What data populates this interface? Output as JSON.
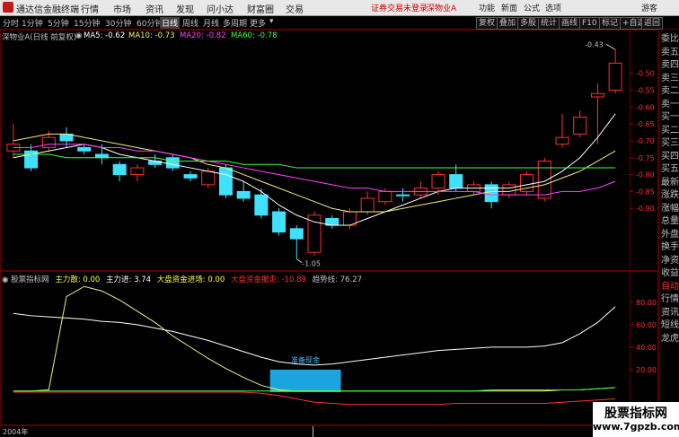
{
  "titlebar": {
    "app_name": "通达信金融终端",
    "menu": [
      "行情",
      "市场",
      "资讯",
      "发现",
      "问小达",
      "财富圈",
      "交易"
    ],
    "warning": "证券交易未登录",
    "stock_tag": "深物业A",
    "right_menu": [
      "功能",
      "新面",
      "公式",
      "选项"
    ],
    "guest": "游客"
  },
  "toolbar": {
    "periods": [
      "分时",
      "1分钟",
      "5分钟",
      "15分钟",
      "30分钟",
      "60分钟",
      "日线",
      "周线",
      "月线",
      "多周期",
      "更多"
    ],
    "active_period": "日线",
    "buttons": [
      "复权",
      "叠加",
      "多股",
      "统计",
      "画线",
      "F10",
      "标记",
      "+自选",
      "返回"
    ]
  },
  "kline_legend": {
    "title": "深物业A(日线 前复权)",
    "ma5": "MA5: -0.62",
    "ma10": "MA10: -0.73",
    "ma20": "MA20: -0.82",
    "ma60": "MA60: -0.78",
    "colors": {
      "ma5": "#ffffff",
      "ma10": "#f0f080",
      "ma20": "#ff40ff",
      "ma60": "#40ff40"
    }
  },
  "indicator_legend": {
    "name": "股票指标网",
    "items": [
      {
        "text": "主力散: 0.00",
        "color": "#ffff40"
      },
      {
        "text": "主力进: 3.74",
        "color": "#ffffff"
      },
      {
        "text": "大盘资金进场: 0.00",
        "color": "#ffff40"
      },
      {
        "text": "大盘资金撤走: -10.89",
        "color": "#ff3030"
      },
      {
        "text": "趋势线: 76.27",
        "color": "#c0c0c0"
      }
    ]
  },
  "annotations": {
    "high_label": "-0.43",
    "low_label": "-1.05",
    "box_label": "准备现金",
    "date_label": "2004年"
  },
  "right_panel": [
    {
      "text": "委比",
      "cls": ""
    },
    {
      "text": "卖五",
      "cls": ""
    },
    {
      "text": "卖四",
      "cls": ""
    },
    {
      "text": "卖三",
      "cls": ""
    },
    {
      "text": "卖二",
      "cls": ""
    },
    {
      "text": "卖一",
      "cls": ""
    },
    {
      "text": "买一",
      "cls": ""
    },
    {
      "text": "买二",
      "cls": ""
    },
    {
      "text": "买三",
      "cls": ""
    },
    {
      "text": "买四",
      "cls": ""
    },
    {
      "text": "买五",
      "cls": ""
    },
    {
      "text": "最新",
      "cls": ""
    },
    {
      "text": "涨跌",
      "cls": ""
    },
    {
      "text": "涨幅",
      "cls": ""
    },
    {
      "text": "总量",
      "cls": ""
    },
    {
      "text": "外盘",
      "cls": ""
    },
    {
      "text": "换手",
      "cls": ""
    },
    {
      "text": "净资",
      "cls": ""
    },
    {
      "text": "收益",
      "cls": ""
    },
    {
      "text": "自动",
      "cls": "up"
    },
    {
      "text": "行情",
      "cls": ""
    },
    {
      "text": "资讯",
      "cls": ""
    },
    {
      "text": "短线",
      "cls": ""
    },
    {
      "text": "龙虎",
      "cls": ""
    }
  ],
  "watermark": {
    "line1": "股票指标网",
    "line2": "www.7gpzb.com"
  },
  "chart_data": [
    {
      "type": "candlestick",
      "ylim": [
        -1.08,
        -0.4
      ],
      "y_ticks": [
        -0.5,
        -0.55,
        -0.6,
        -0.65,
        -0.7,
        -0.75,
        -0.8,
        -0.85,
        -0.9
      ],
      "candles": [
        {
          "o": -0.73,
          "c": -0.71,
          "h": -0.65,
          "l": -0.75
        },
        {
          "o": -0.73,
          "c": -0.78,
          "h": -0.71,
          "l": -0.79
        },
        {
          "o": -0.72,
          "c": -0.69,
          "h": -0.67,
          "l": -0.73
        },
        {
          "o": -0.68,
          "c": -0.7,
          "h": -0.66,
          "l": -0.72
        },
        {
          "o": -0.72,
          "c": -0.73,
          "h": -0.71,
          "l": -0.74
        },
        {
          "o": -0.74,
          "c": -0.75,
          "h": -0.71,
          "l": -0.77
        },
        {
          "o": -0.77,
          "c": -0.8,
          "h": -0.76,
          "l": -0.82
        },
        {
          "o": -0.8,
          "c": -0.78,
          "h": -0.77,
          "l": -0.82
        },
        {
          "o": -0.76,
          "c": -0.77,
          "h": -0.74,
          "l": -0.78
        },
        {
          "o": -0.75,
          "c": -0.78,
          "h": -0.74,
          "l": -0.79
        },
        {
          "o": -0.8,
          "c": -0.81,
          "h": -0.79,
          "l": -0.82
        },
        {
          "o": -0.83,
          "c": -0.79,
          "h": -0.78,
          "l": -0.84
        },
        {
          "o": -0.78,
          "c": -0.86,
          "h": -0.77,
          "l": -0.87
        },
        {
          "o": -0.85,
          "c": -0.87,
          "h": -0.82,
          "l": -0.88
        },
        {
          "o": -0.86,
          "c": -0.92,
          "h": -0.84,
          "l": -0.93
        },
        {
          "o": -0.91,
          "c": -0.97,
          "h": -0.9,
          "l": -0.98
        },
        {
          "o": -0.96,
          "c": -0.99,
          "h": -0.95,
          "l": -1.05
        },
        {
          "o": -1.03,
          "c": -0.92,
          "h": -0.91,
          "l": -1.04
        },
        {
          "o": -0.93,
          "c": -0.95,
          "h": -0.92,
          "l": -0.96
        },
        {
          "o": -0.95,
          "c": -0.91,
          "h": -0.9,
          "l": -0.96
        },
        {
          "o": -0.91,
          "c": -0.87,
          "h": -0.85,
          "l": -0.92
        },
        {
          "o": -0.88,
          "c": -0.85,
          "h": -0.84,
          "l": -0.89
        },
        {
          "o": -0.86,
          "c": -0.86,
          "h": -0.84,
          "l": -0.88
        },
        {
          "o": -0.86,
          "c": -0.84,
          "h": -0.82,
          "l": -0.87
        },
        {
          "o": -0.84,
          "c": -0.8,
          "h": -0.79,
          "l": -0.86
        },
        {
          "o": -0.8,
          "c": -0.84,
          "h": -0.77,
          "l": -0.85
        },
        {
          "o": -0.85,
          "c": -0.83,
          "h": -0.82,
          "l": -0.86
        },
        {
          "o": -0.83,
          "c": -0.88,
          "h": -0.82,
          "l": -0.9
        },
        {
          "o": -0.86,
          "c": -0.83,
          "h": -0.82,
          "l": -0.87
        },
        {
          "o": -0.85,
          "c": -0.8,
          "h": -0.79,
          "l": -0.86
        },
        {
          "o": -0.87,
          "c": -0.76,
          "h": -0.75,
          "l": -0.88
        },
        {
          "o": -0.71,
          "c": -0.69,
          "h": -0.62,
          "l": -0.72
        },
        {
          "o": -0.68,
          "c": -0.63,
          "h": -0.61,
          "l": -0.69
        },
        {
          "o": -0.57,
          "c": -0.56,
          "h": -0.53,
          "l": -0.71
        },
        {
          "o": -0.55,
          "c": -0.47,
          "h": -0.43,
          "l": -0.56
        }
      ],
      "ma": [
        {
          "name": "MA5",
          "color": "#ffffff",
          "values": [
            -0.75,
            -0.74,
            -0.73,
            -0.72,
            -0.71,
            -0.72,
            -0.74,
            -0.75,
            -0.76,
            -0.77,
            -0.78,
            -0.79,
            -0.8,
            -0.82,
            -0.85,
            -0.89,
            -0.92,
            -0.94,
            -0.95,
            -0.95,
            -0.93,
            -0.91,
            -0.89,
            -0.87,
            -0.85,
            -0.84,
            -0.84,
            -0.84,
            -0.84,
            -0.83,
            -0.82,
            -0.79,
            -0.75,
            -0.69,
            -0.62
          ]
        },
        {
          "name": "MA10",
          "color": "#f0f080",
          "values": [
            -0.7,
            -0.69,
            -0.68,
            -0.68,
            -0.69,
            -0.7,
            -0.71,
            -0.72,
            -0.73,
            -0.74,
            -0.75,
            -0.77,
            -0.78,
            -0.8,
            -0.82,
            -0.84,
            -0.86,
            -0.88,
            -0.9,
            -0.91,
            -0.91,
            -0.91,
            -0.9,
            -0.89,
            -0.88,
            -0.87,
            -0.86,
            -0.85,
            -0.85,
            -0.84,
            -0.83,
            -0.81,
            -0.79,
            -0.76,
            -0.73
          ]
        },
        {
          "name": "MA20",
          "color": "#ff40ff",
          "values": [
            -0.72,
            -0.72,
            -0.71,
            -0.71,
            -0.71,
            -0.72,
            -0.72,
            -0.73,
            -0.73,
            -0.74,
            -0.75,
            -0.76,
            -0.77,
            -0.78,
            -0.79,
            -0.8,
            -0.81,
            -0.82,
            -0.83,
            -0.84,
            -0.84,
            -0.85,
            -0.85,
            -0.85,
            -0.85,
            -0.85,
            -0.85,
            -0.86,
            -0.86,
            -0.86,
            -0.86,
            -0.85,
            -0.85,
            -0.84,
            -0.82
          ]
        },
        {
          "name": "MA60",
          "color": "#40ff40",
          "values": [
            -0.74,
            -0.74,
            -0.74,
            -0.75,
            -0.75,
            -0.75,
            -0.75,
            -0.75,
            -0.75,
            -0.76,
            -0.76,
            -0.76,
            -0.76,
            -0.77,
            -0.77,
            -0.77,
            -0.78,
            -0.78,
            -0.78,
            -0.78,
            -0.78,
            -0.78,
            -0.78,
            -0.78,
            -0.78,
            -0.78,
            -0.78,
            -0.78,
            -0.78,
            -0.78,
            -0.78,
            -0.78,
            -0.78,
            -0.78,
            -0.78
          ]
        }
      ]
    },
    {
      "type": "line",
      "ylim": [
        -12,
        95
      ],
      "y_ticks": [
        20.0,
        40.0,
        60.0,
        80.0
      ],
      "series": [
        {
          "name": "主力进",
          "color": "#ffffff",
          "values": [
            70,
            68,
            67,
            66,
            65,
            63,
            62,
            60,
            57,
            54,
            50,
            46,
            41,
            36,
            31,
            27,
            25,
            24,
            25,
            27,
            29,
            31,
            33,
            35,
            37,
            38,
            39,
            40,
            40,
            40,
            41,
            44,
            52,
            62,
            76
          ]
        },
        {
          "name": "主力散",
          "color": "#f0f080",
          "values": [
            1,
            1,
            2,
            85,
            94,
            90,
            82,
            72,
            62,
            50,
            40,
            30,
            21,
            13,
            6,
            2,
            1,
            1,
            1,
            1,
            1,
            1,
            1,
            1,
            1,
            1,
            1,
            1,
            1,
            1,
            1,
            2,
            2,
            3,
            4
          ]
        },
        {
          "name": "大盘资金撤走",
          "color": "#ff3030",
          "values": [
            0,
            0,
            0,
            0,
            0,
            0,
            0,
            0,
            0,
            0,
            0,
            0,
            0,
            0,
            -1,
            -3,
            -6,
            -9,
            -10,
            -11,
            -11,
            -11,
            -11,
            -11,
            -11,
            -10,
            -10,
            -10,
            -10,
            -10,
            -10,
            -9,
            -8,
            -7,
            -6
          ]
        },
        {
          "name": "趋势线",
          "color": "#40ff40",
          "values": [
            1,
            1,
            1,
            1,
            1,
            1,
            1,
            1,
            1,
            1,
            1,
            1,
            1,
            1,
            1,
            1,
            1,
            1,
            1,
            1,
            1,
            1,
            1,
            1,
            1,
            1,
            1,
            2,
            2,
            2,
            2,
            2,
            2,
            3,
            4
          ]
        }
      ],
      "bars": [
        {
          "from": 15,
          "to": 18,
          "value": 20,
          "color": "#1aa5e0"
        }
      ]
    }
  ]
}
